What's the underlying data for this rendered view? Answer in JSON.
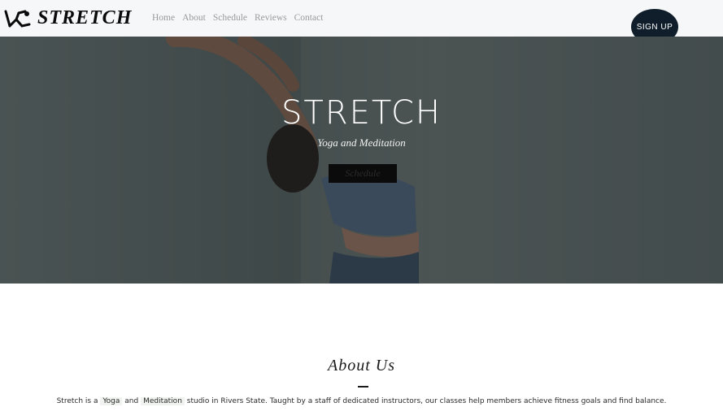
{
  "header": {
    "logo_text": "STRETCH",
    "nav": [
      "Home",
      "About",
      "Schedule",
      "Reviews",
      "Contact"
    ],
    "signup_label": "SIGN UP"
  },
  "hero": {
    "title": "STRETCH",
    "subtitle": "Yoga and Meditation",
    "button_label": "Schedule"
  },
  "about": {
    "title": "About Us",
    "text_before": "Stretch is a",
    "yoga": "Yoga",
    "and": "and",
    "meditation": "Meditation",
    "text_after": "studio in Rivers State. Taught by a staff of dedicated instructors, our classes help members achieve fitness goals and find balance."
  },
  "colors": {
    "header_bg": "#f6f7f9",
    "signup_bg": "#0f1e2a",
    "hero_overlay": "#434c4d"
  }
}
